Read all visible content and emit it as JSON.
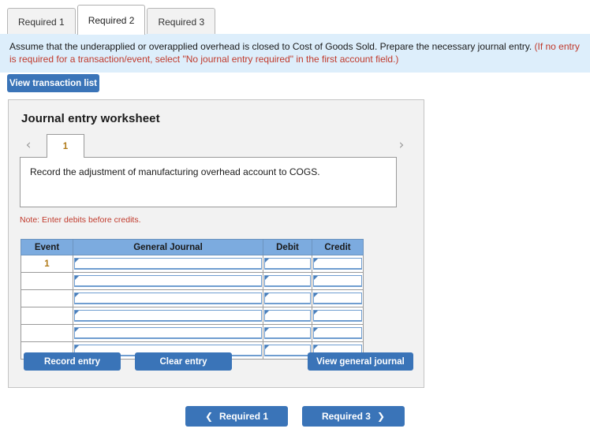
{
  "tabs": [
    {
      "label": "Required 1",
      "active": false
    },
    {
      "label": "Required 2",
      "active": true
    },
    {
      "label": "Required 3",
      "active": false
    }
  ],
  "instructions": {
    "black_text": "Assume that the underapplied or overapplied overhead is closed to Cost of Goods Sold. Prepare the necessary journal entry. ",
    "red_text": "(If no entry is required for a transaction/event, select \"No journal entry required\" in the first account field.)"
  },
  "toolbar": {
    "view_transaction_list": "View transaction list"
  },
  "panel": {
    "title": "Journal entry worksheet",
    "pager": {
      "prev_icon": "‹",
      "next_icon": "›",
      "current_page": "1"
    },
    "description": "Record the adjustment of manufacturing overhead account to COGS.",
    "note": "Note: Enter debits before credits."
  },
  "table": {
    "headers": [
      "Event",
      "General Journal",
      "Debit",
      "Credit"
    ],
    "rows": [
      {
        "event": "1",
        "general_journal": "",
        "debit": "",
        "credit": ""
      },
      {
        "event": "",
        "general_journal": "",
        "debit": "",
        "credit": ""
      },
      {
        "event": "",
        "general_journal": "",
        "debit": "",
        "credit": ""
      },
      {
        "event": "",
        "general_journal": "",
        "debit": "",
        "credit": ""
      },
      {
        "event": "",
        "general_journal": "",
        "debit": "",
        "credit": ""
      },
      {
        "event": "",
        "general_journal": "",
        "debit": "",
        "credit": ""
      }
    ]
  },
  "actions": {
    "record_entry": "Record entry",
    "clear_entry": "Clear entry",
    "view_general_journal": "View general journal"
  },
  "bottom_nav": {
    "prev": {
      "label": "Required 1",
      "arrow": "❮"
    },
    "next": {
      "label": "Required 3",
      "arrow": "❯"
    }
  },
  "colors": {
    "accent_blue": "#3a74b8",
    "banner_blue": "#ddeefb",
    "table_header_blue": "#7cabdf",
    "note_red": "#c0392b",
    "event_gold": "#b07a18",
    "panel_gray": "#f2f2f2"
  }
}
